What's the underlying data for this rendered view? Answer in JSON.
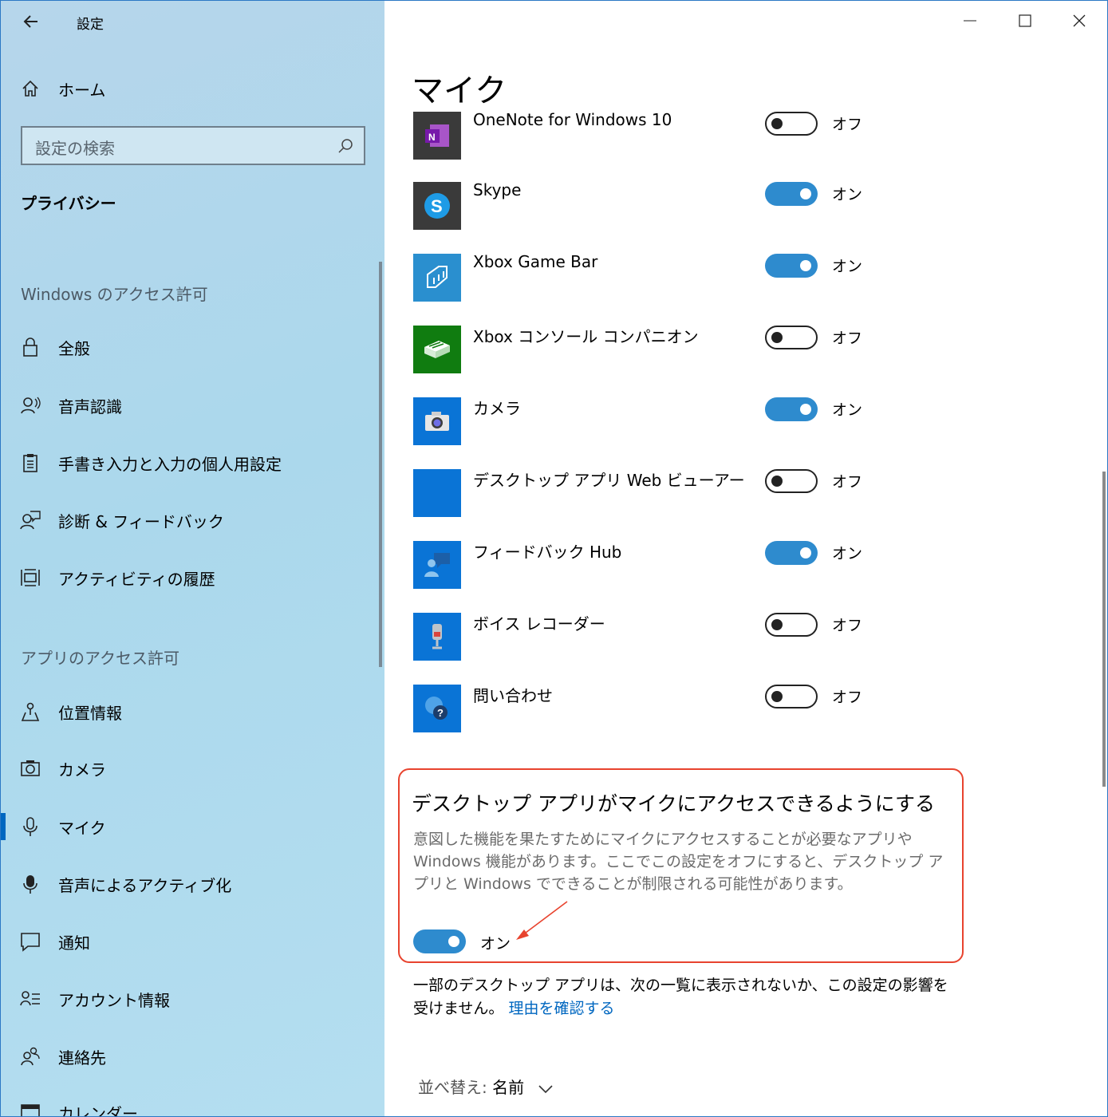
{
  "window": {
    "title": "設定",
    "controls": [
      "minimize",
      "maximize",
      "close"
    ]
  },
  "sidebar": {
    "home_label": "ホーム",
    "search_placeholder": "設定の検索",
    "category": "プライバシー",
    "section_windows": "Windows のアクセス許可",
    "windows_items": [
      {
        "label": "全般",
        "icon": "lock-icon"
      },
      {
        "label": "音声認識",
        "icon": "speech-icon"
      },
      {
        "label": "手書き入力と入力の個人用設定",
        "icon": "clipboard-icon"
      },
      {
        "label": "診断 & フィードバック",
        "icon": "feedback-icon"
      },
      {
        "label": "アクティビティの履歴",
        "icon": "timeline-icon"
      }
    ],
    "section_apps": "アプリのアクセス許可",
    "app_items": [
      {
        "label": "位置情報",
        "icon": "location-icon"
      },
      {
        "label": "カメラ",
        "icon": "camera-icon"
      },
      {
        "label": "マイク",
        "icon": "microphone-icon",
        "selected": true
      },
      {
        "label": "音声によるアクティブ化",
        "icon": "voice-activation-icon"
      },
      {
        "label": "通知",
        "icon": "notification-icon"
      },
      {
        "label": "アカウント情報",
        "icon": "account-info-icon"
      },
      {
        "label": "連絡先",
        "icon": "contacts-icon"
      },
      {
        "label": "カレンダー",
        "icon": "calendar-icon"
      }
    ]
  },
  "main": {
    "page_title": "マイク",
    "apps": [
      {
        "name": "OneNote for Windows 10",
        "state": "オフ",
        "on": false,
        "icon": "onenote-icon",
        "tile_color": "#3a3a3a"
      },
      {
        "name": "Skype",
        "state": "オン",
        "on": true,
        "icon": "skype-icon",
        "tile_color": "#3a3a3a"
      },
      {
        "name": "Xbox Game Bar",
        "state": "オン",
        "on": true,
        "icon": "xbox-game-bar-icon",
        "tile_color": "#2a8fcf"
      },
      {
        "name": "Xbox コンソール コンパニオン",
        "state": "オフ",
        "on": false,
        "icon": "xbox-console-icon",
        "tile_color": "#107c10"
      },
      {
        "name": "カメラ",
        "state": "オン",
        "on": true,
        "icon": "camera-app-icon",
        "tile_color": "#0a74d6"
      },
      {
        "name": "デスクトップ アプリ Web ビューアー",
        "state": "オフ",
        "on": false,
        "icon": "web-viewer-icon",
        "tile_color": "#0a74d6"
      },
      {
        "name": "フィードバック Hub",
        "state": "オン",
        "on": true,
        "icon": "feedback-hub-icon",
        "tile_color": "#0a74d6"
      },
      {
        "name": "ボイス レコーダー",
        "state": "オフ",
        "on": false,
        "icon": "voice-recorder-icon",
        "tile_color": "#0a74d6"
      },
      {
        "name": "問い合わせ",
        "state": "オフ",
        "on": false,
        "icon": "get-help-icon",
        "tile_color": "#0a74d6"
      }
    ],
    "desktop_section": {
      "title": "デスクトップ アプリがマイクにアクセスできるようにする",
      "description": "意図した機能を果たすためにマイクにアクセスすることが必要なアプリや Windows 機能があります。ここでこの設定をオフにすると、デスクトップ アプリと Windows でできることが制限される可能性があります。",
      "state": "オン"
    },
    "note_text": "一部のデスクトップ アプリは、次の一覧に表示されないか、この設定の影響を受けません。",
    "note_link": "理由を確認する",
    "sort_label": "並べ替え:",
    "sort_value": "名前"
  },
  "colors": {
    "accent": "#2e8bce",
    "link": "#0067c0",
    "annotation": "#e8432e"
  }
}
